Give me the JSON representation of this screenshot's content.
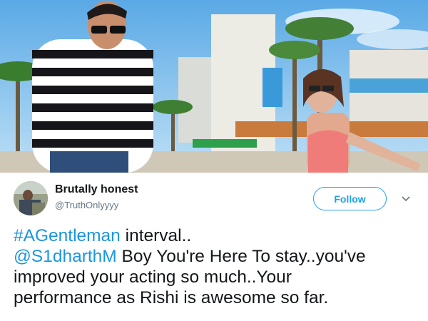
{
  "tweet": {
    "display_name": "Brutally honest",
    "handle": "@TruthOnlyyyy",
    "follow_label": "Follow",
    "hashtag": "#AGentleman",
    "line1_rest": " interval..",
    "mention": "@S1dharthM",
    "line2_rest": " Boy You're Here To stay..you've",
    "line3": "improved your acting so much..Your",
    "line4": "performance as Rishi is awesome so far."
  },
  "colors": {
    "link": "#1b95e0",
    "follow_border": "#1da1f2",
    "name": "#14171a",
    "handle": "#657786"
  },
  "icons": [
    "chevron-down-icon"
  ]
}
